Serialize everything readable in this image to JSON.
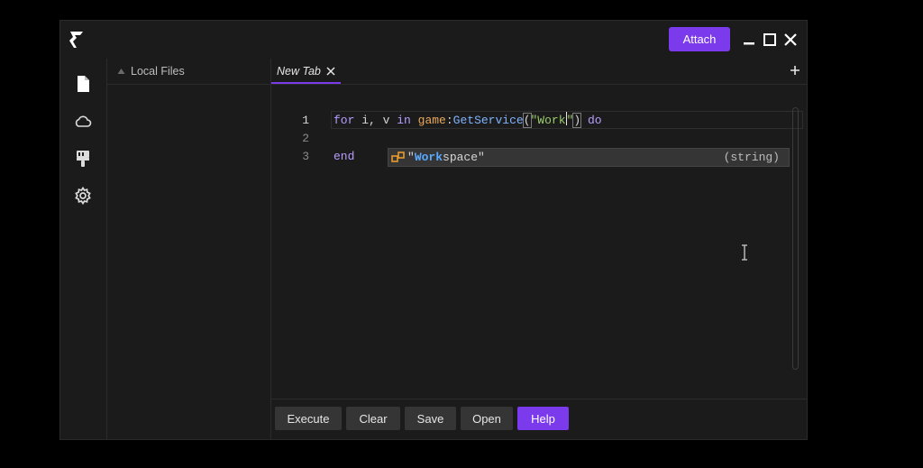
{
  "titlebar": {
    "attach_label": "Attach",
    "icons": [
      "logo-icon",
      "minimize-icon",
      "maximize-icon",
      "close-icon"
    ]
  },
  "sidebar": {
    "icons": [
      "file-icon",
      "cloud-icon",
      "paint-brush-icon",
      "gear-icon"
    ]
  },
  "files_panel": {
    "title": "Local Files"
  },
  "tabs": [
    {
      "label": "New Tab",
      "active": true
    }
  ],
  "editor": {
    "lines": [
      {
        "number": "1",
        "active": true
      },
      {
        "number": "2",
        "active": false
      },
      {
        "number": "3",
        "active": false
      }
    ],
    "code": {
      "l1_for": "for",
      "l1_vars": " i, v ",
      "l1_in": "in",
      "l1_space": " ",
      "l1_game": "game",
      "l1_colon": ":",
      "l1_fn": "GetService",
      "l1_open": "(",
      "l1_str": "\"Work",
      "l1_quote": "\"",
      "l1_close": ")",
      "l1_do": " do",
      "l3_end": "end"
    },
    "autocomplete": {
      "quote_open": "\"",
      "match": "Work",
      "rest": "space\"",
      "type": "(string)"
    }
  },
  "bottom_buttons": {
    "execute": "Execute",
    "clear": "Clear",
    "save": "Save",
    "open": "Open",
    "help": "Help"
  },
  "colors": {
    "accent": "#7c3aed",
    "background": "#1b1b1b",
    "button": "#353535",
    "keyword": "#b89cff",
    "function": "#7fb4ff",
    "string": "#9acd6a",
    "object": "#e9a85c"
  }
}
